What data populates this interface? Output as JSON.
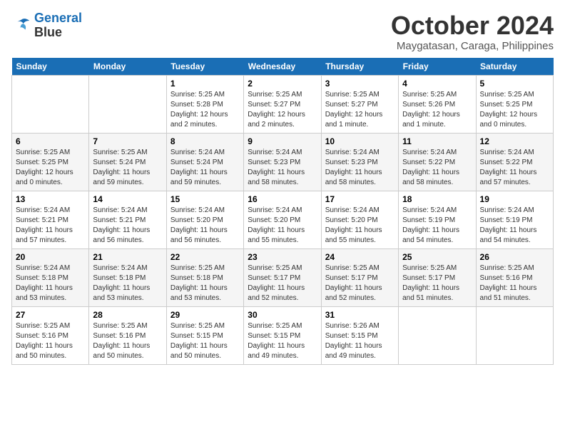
{
  "logo": {
    "line1": "General",
    "line2": "Blue"
  },
  "title": "October 2024",
  "subtitle": "Maygatasan, Caraga, Philippines",
  "weekdays": [
    "Sunday",
    "Monday",
    "Tuesday",
    "Wednesday",
    "Thursday",
    "Friday",
    "Saturday"
  ],
  "weeks": [
    [
      {
        "day": "",
        "info": ""
      },
      {
        "day": "",
        "info": ""
      },
      {
        "day": "1",
        "info": "Sunrise: 5:25 AM\nSunset: 5:28 PM\nDaylight: 12 hours\nand 2 minutes."
      },
      {
        "day": "2",
        "info": "Sunrise: 5:25 AM\nSunset: 5:27 PM\nDaylight: 12 hours\nand 2 minutes."
      },
      {
        "day": "3",
        "info": "Sunrise: 5:25 AM\nSunset: 5:27 PM\nDaylight: 12 hours\nand 1 minute."
      },
      {
        "day": "4",
        "info": "Sunrise: 5:25 AM\nSunset: 5:26 PM\nDaylight: 12 hours\nand 1 minute."
      },
      {
        "day": "5",
        "info": "Sunrise: 5:25 AM\nSunset: 5:25 PM\nDaylight: 12 hours\nand 0 minutes."
      }
    ],
    [
      {
        "day": "6",
        "info": "Sunrise: 5:25 AM\nSunset: 5:25 PM\nDaylight: 12 hours\nand 0 minutes."
      },
      {
        "day": "7",
        "info": "Sunrise: 5:25 AM\nSunset: 5:24 PM\nDaylight: 11 hours\nand 59 minutes."
      },
      {
        "day": "8",
        "info": "Sunrise: 5:24 AM\nSunset: 5:24 PM\nDaylight: 11 hours\nand 59 minutes."
      },
      {
        "day": "9",
        "info": "Sunrise: 5:24 AM\nSunset: 5:23 PM\nDaylight: 11 hours\nand 58 minutes."
      },
      {
        "day": "10",
        "info": "Sunrise: 5:24 AM\nSunset: 5:23 PM\nDaylight: 11 hours\nand 58 minutes."
      },
      {
        "day": "11",
        "info": "Sunrise: 5:24 AM\nSunset: 5:22 PM\nDaylight: 11 hours\nand 58 minutes."
      },
      {
        "day": "12",
        "info": "Sunrise: 5:24 AM\nSunset: 5:22 PM\nDaylight: 11 hours\nand 57 minutes."
      }
    ],
    [
      {
        "day": "13",
        "info": "Sunrise: 5:24 AM\nSunset: 5:21 PM\nDaylight: 11 hours\nand 57 minutes."
      },
      {
        "day": "14",
        "info": "Sunrise: 5:24 AM\nSunset: 5:21 PM\nDaylight: 11 hours\nand 56 minutes."
      },
      {
        "day": "15",
        "info": "Sunrise: 5:24 AM\nSunset: 5:20 PM\nDaylight: 11 hours\nand 56 minutes."
      },
      {
        "day": "16",
        "info": "Sunrise: 5:24 AM\nSunset: 5:20 PM\nDaylight: 11 hours\nand 55 minutes."
      },
      {
        "day": "17",
        "info": "Sunrise: 5:24 AM\nSunset: 5:20 PM\nDaylight: 11 hours\nand 55 minutes."
      },
      {
        "day": "18",
        "info": "Sunrise: 5:24 AM\nSunset: 5:19 PM\nDaylight: 11 hours\nand 54 minutes."
      },
      {
        "day": "19",
        "info": "Sunrise: 5:24 AM\nSunset: 5:19 PM\nDaylight: 11 hours\nand 54 minutes."
      }
    ],
    [
      {
        "day": "20",
        "info": "Sunrise: 5:24 AM\nSunset: 5:18 PM\nDaylight: 11 hours\nand 53 minutes."
      },
      {
        "day": "21",
        "info": "Sunrise: 5:24 AM\nSunset: 5:18 PM\nDaylight: 11 hours\nand 53 minutes."
      },
      {
        "day": "22",
        "info": "Sunrise: 5:25 AM\nSunset: 5:18 PM\nDaylight: 11 hours\nand 53 minutes."
      },
      {
        "day": "23",
        "info": "Sunrise: 5:25 AM\nSunset: 5:17 PM\nDaylight: 11 hours\nand 52 minutes."
      },
      {
        "day": "24",
        "info": "Sunrise: 5:25 AM\nSunset: 5:17 PM\nDaylight: 11 hours\nand 52 minutes."
      },
      {
        "day": "25",
        "info": "Sunrise: 5:25 AM\nSunset: 5:17 PM\nDaylight: 11 hours\nand 51 minutes."
      },
      {
        "day": "26",
        "info": "Sunrise: 5:25 AM\nSunset: 5:16 PM\nDaylight: 11 hours\nand 51 minutes."
      }
    ],
    [
      {
        "day": "27",
        "info": "Sunrise: 5:25 AM\nSunset: 5:16 PM\nDaylight: 11 hours\nand 50 minutes."
      },
      {
        "day": "28",
        "info": "Sunrise: 5:25 AM\nSunset: 5:16 PM\nDaylight: 11 hours\nand 50 minutes."
      },
      {
        "day": "29",
        "info": "Sunrise: 5:25 AM\nSunset: 5:15 PM\nDaylight: 11 hours\nand 50 minutes."
      },
      {
        "day": "30",
        "info": "Sunrise: 5:25 AM\nSunset: 5:15 PM\nDaylight: 11 hours\nand 49 minutes."
      },
      {
        "day": "31",
        "info": "Sunrise: 5:26 AM\nSunset: 5:15 PM\nDaylight: 11 hours\nand 49 minutes."
      },
      {
        "day": "",
        "info": ""
      },
      {
        "day": "",
        "info": ""
      }
    ]
  ]
}
